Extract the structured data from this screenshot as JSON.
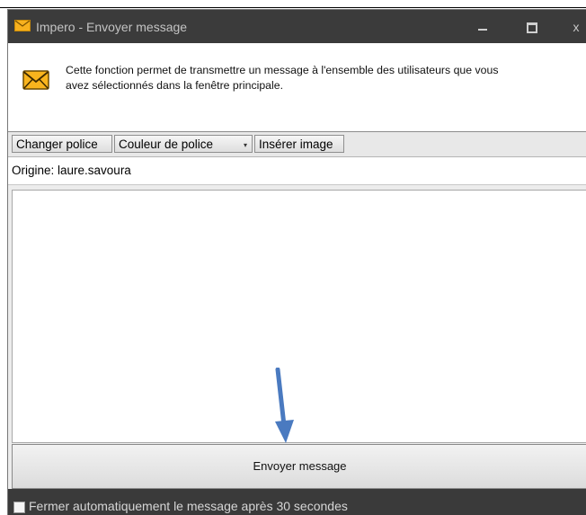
{
  "window": {
    "title": "Impero - Envoyer message",
    "minimize_icon": "minimize-icon",
    "maximize_icon": "maximize-icon",
    "close_icon": "close-icon",
    "close_glyph": "x"
  },
  "info": {
    "icon": "envelope-icon",
    "line1": "Cette fonction permet de transmettre un message à l'ensemble des utilisateurs que vous",
    "line2": "avez sélectionnés dans la fenêtre principale."
  },
  "toolbar": {
    "change_font": "Changer police",
    "font_color": "Couleur de police",
    "font_color_caret": "▾",
    "insert_image": "Insérer image"
  },
  "origin": {
    "text": "Origine: laure.savoura"
  },
  "message": {
    "value": "",
    "annotation_arrow": "down-arrow-icon",
    "arrow_color": "#4a7ac0"
  },
  "send_button": {
    "label": "Envoyer message"
  },
  "footer": {
    "checkbox_label": "Fermer automatiquement le message après 30 secondes",
    "checked": false
  },
  "colors": {
    "titlebar": "#3b3b3b",
    "envelope": "#f7b11e"
  }
}
